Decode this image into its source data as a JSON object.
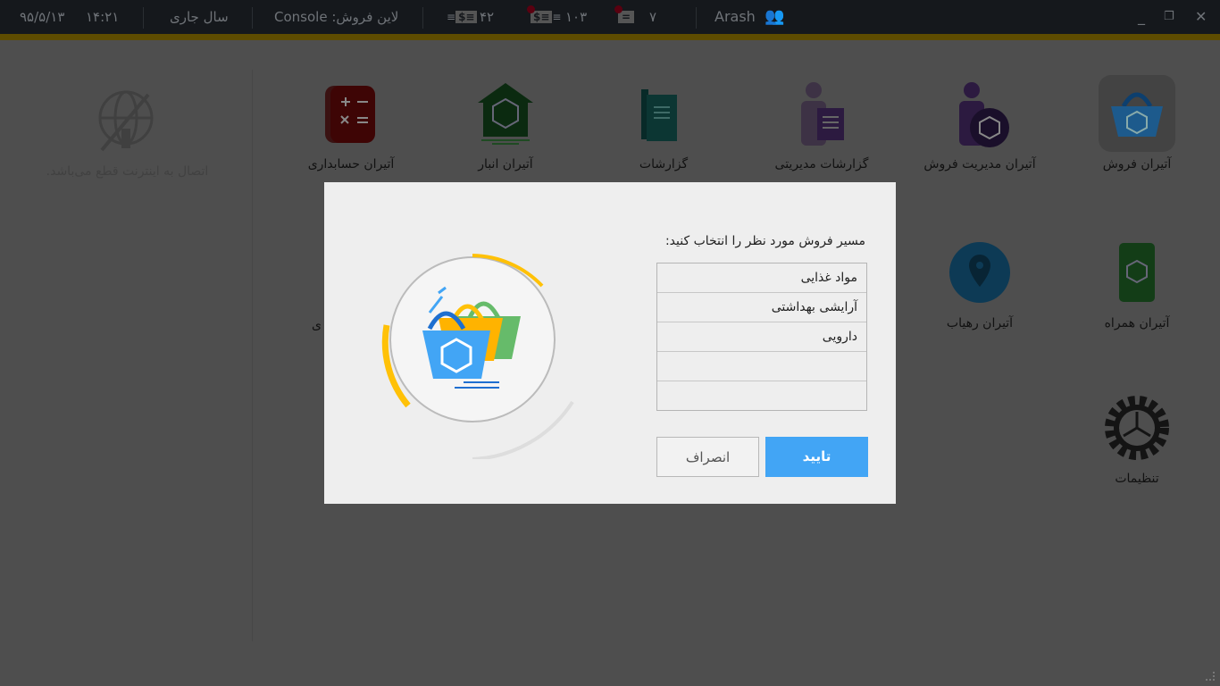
{
  "topbar": {
    "date": "۹۵/۵/۱۳",
    "time": "۱۴:۲۱",
    "fiscal_year": "سال جاری",
    "console": "Console :لاین فروش",
    "count_invoices": "۴۲",
    "count_receipts": "۱۰۳",
    "count_cheques": "۷",
    "user": "Arash"
  },
  "window": {
    "minimize": "_",
    "restore": "❐",
    "close": "✕"
  },
  "apps": [
    {
      "label": "آتیران فروش",
      "icon": "basket-icon"
    },
    {
      "label": "آتیران مدیریت فروش",
      "icon": "sales-manager-icon"
    },
    {
      "label": "گزارشات مدیریتی",
      "icon": "management-report-icon"
    },
    {
      "label": "گزارشات",
      "icon": "scroll-report-icon"
    },
    {
      "label": "آتیران انبار",
      "icon": "warehouse-icon"
    },
    {
      "label": "آتیران حسابداری",
      "icon": "calculator-icon"
    },
    {
      "label": "آتیران همراه",
      "icon": "mobile-icon"
    },
    {
      "label": "آتیران رهیاب",
      "icon": "location-pin-icon"
    },
    {
      "label": "تنظیمات",
      "icon": "gear-icon"
    },
    {
      "label": "ی",
      "icon": ""
    }
  ],
  "offline": {
    "message": "اتصال به اینترنت قطع می‌باشد.",
    "icon": "no-internet-icon"
  },
  "dialog": {
    "prompt": "مسیر فروش مورد نظر را انتخاب کنید:",
    "routes": [
      "مواد غذایی",
      "آرایشی بهداشتی",
      "دارویی",
      "",
      ""
    ],
    "ok": "تایید",
    "cancel": "انصراف"
  },
  "colors": {
    "accent": "#42a5f5",
    "topbar": "#15181c",
    "overlay": "#4e4e4e"
  }
}
